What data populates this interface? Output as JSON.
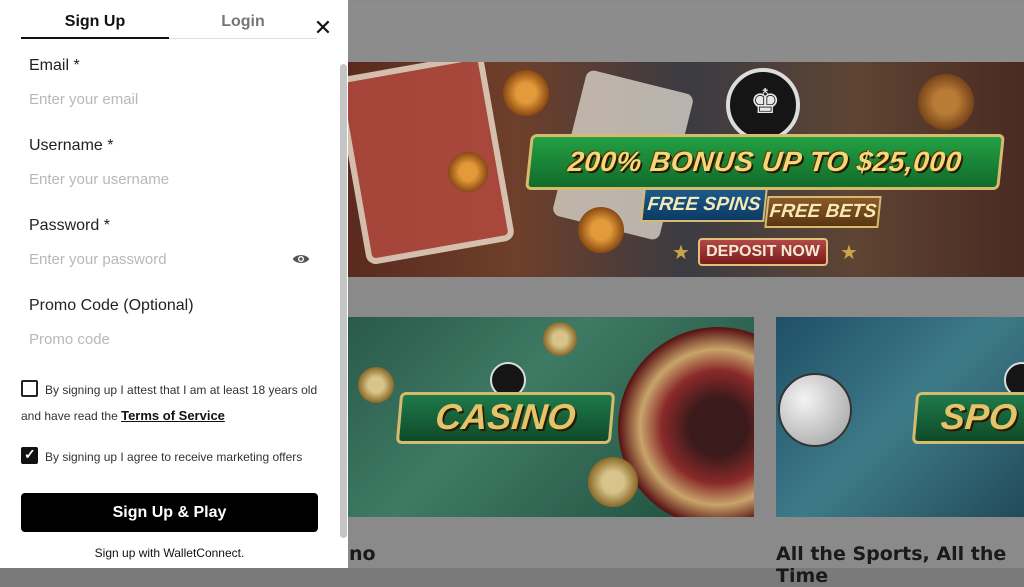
{
  "modal": {
    "tabs": [
      {
        "label": "Sign Up",
        "active": true
      },
      {
        "label": "Login",
        "active": false
      }
    ],
    "close_icon": "close-icon",
    "fields": {
      "email": {
        "label": "Email *",
        "placeholder": "Enter your email"
      },
      "username": {
        "label": "Username *",
        "placeholder": "Enter your username"
      },
      "password": {
        "label": "Password *",
        "placeholder": "Enter your password",
        "icon": "eye-icon"
      },
      "promo": {
        "label": "Promo Code (Optional)",
        "placeholder": "Promo code"
      }
    },
    "checkboxes": {
      "age": {
        "text": "By signing up I attest that I am at least 18 years old and have read the",
        "link": "Terms of Service",
        "checked": false
      },
      "marketing": {
        "text": "By signing up I agree to receive marketing offers",
        "checked": true
      }
    },
    "submit_label": "Sign Up & Play",
    "wallet_text": "Sign up with WalletConnect."
  },
  "background": {
    "hero": {
      "headline": "200% BONUS UP TO $25,000",
      "free_spins": "FREE SPINS",
      "free_bets": "FREE BETS",
      "deposit": "DEPOSIT NOW"
    },
    "tiles": [
      {
        "banner": "CASINO",
        "caption": "no"
      },
      {
        "banner": "SPO",
        "caption": "All the Sports, All the Time"
      }
    ]
  },
  "colors": {
    "primary": "#000000",
    "overlay": "#8a8a8a",
    "banner_gold": "#d6ba6e"
  }
}
